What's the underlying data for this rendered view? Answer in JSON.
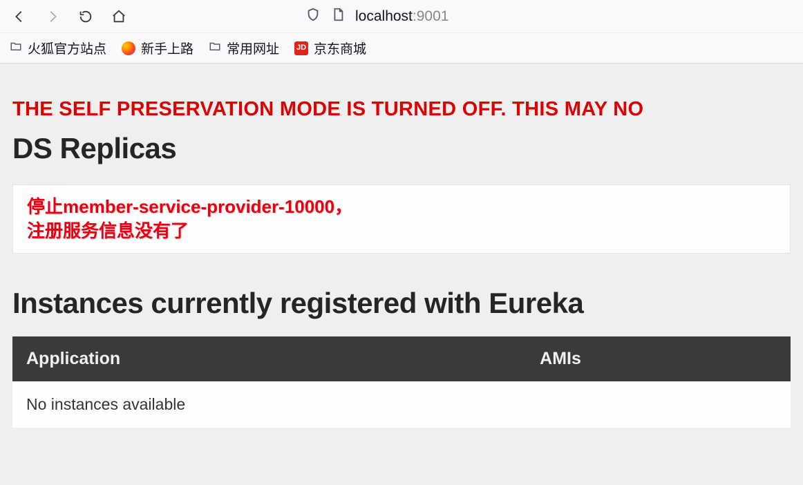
{
  "browser": {
    "url": {
      "host": "localhost",
      "port": ":9001"
    },
    "bookmarks": [
      {
        "label": "火狐官方站点",
        "icon": "folder"
      },
      {
        "label": "新手上路",
        "icon": "firefox"
      },
      {
        "label": "常用网址",
        "icon": "folder"
      },
      {
        "label": "京东商城",
        "icon": "jd",
        "badge": "JD"
      }
    ]
  },
  "page": {
    "warning": "THE SELF PRESERVATION MODE IS TURNED OFF. THIS MAY NO",
    "ds_replicas_heading": "DS Replicas",
    "annotation_line1": "停止member-service-provider-10000，",
    "annotation_line2": "注册服务信息没有了",
    "instances_heading": "Instances currently registered with Eureka",
    "table": {
      "headers": [
        "Application",
        "AMIs"
      ],
      "empty_message": "No instances available"
    }
  }
}
